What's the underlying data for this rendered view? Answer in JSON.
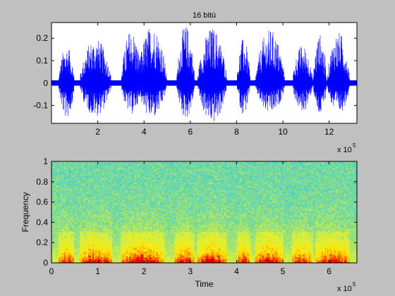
{
  "figure": {
    "background": "#c0c0c0",
    "axes_background": "#ffffff",
    "axis_color": "#000000"
  },
  "chart_data": [
    {
      "type": "line",
      "title": "16 bitù",
      "xlabel": "",
      "ylabel": "",
      "x_exponent_label": "x 10",
      "x_exponent": "5",
      "xlim": [
        0,
        132000
      ],
      "ylim": [
        -0.18,
        0.27
      ],
      "xticks": [
        2,
        4,
        6,
        8,
        10,
        12
      ],
      "yticks": [
        -0.1,
        0,
        0.1,
        0.2
      ],
      "ytick_labels": [
        "-0.1",
        "0",
        "0.1",
        "0.2"
      ],
      "line_color": "#0000ff",
      "series_description": "speech waveform with 13 bursts",
      "bursts": [
        {
          "start": 0.3,
          "end": 1.0,
          "peak": 0.17,
          "min": -0.16
        },
        {
          "start": 1.2,
          "end": 2.6,
          "peak": 0.2,
          "min": -0.15
        },
        {
          "start": 3.0,
          "end": 3.9,
          "peak": 0.24,
          "min": -0.14
        },
        {
          "start": 3.7,
          "end": 5.0,
          "peak": 0.26,
          "min": -0.16
        },
        {
          "start": 5.4,
          "end": 6.2,
          "peak": 0.26,
          "min": -0.16
        },
        {
          "start": 6.3,
          "end": 7.6,
          "peak": 0.25,
          "min": -0.18
        },
        {
          "start": 8.0,
          "end": 8.6,
          "peak": 0.2,
          "min": -0.14
        },
        {
          "start": 8.8,
          "end": 10.1,
          "peak": 0.24,
          "min": -0.14
        },
        {
          "start": 10.4,
          "end": 11.3,
          "peak": 0.17,
          "min": -0.13
        },
        {
          "start": 11.3,
          "end": 11.9,
          "peak": 0.22,
          "min": -0.15
        },
        {
          "start": 11.9,
          "end": 12.9,
          "peak": 0.23,
          "min": -0.14
        }
      ],
      "noise_floor": 0.012
    },
    {
      "type": "heatmap",
      "title": "",
      "xlabel": "Time",
      "ylabel": "Frequency",
      "x_exponent_label": "x 10",
      "x_exponent": "5",
      "xlim": [
        0,
        6.6
      ],
      "ylim": [
        0,
        1
      ],
      "xticks": [
        0,
        1,
        2,
        3,
        4,
        5,
        6
      ],
      "yticks": [
        0,
        0.2,
        0.4,
        0.6,
        0.8,
        1
      ],
      "ytick_labels": [
        "0",
        "0.2",
        "0.4",
        "0.6",
        "0.8",
        "1"
      ],
      "colormap": [
        "#0000ff",
        "#00ffff",
        "#80ff80",
        "#ffff00",
        "#ff8000",
        "#ff0000"
      ],
      "background_color": "#6fd7a8",
      "energy_low": [
        0.3,
        0.45,
        0.95,
        1.5,
        1.9,
        2.6,
        3.2,
        3.9,
        4.4,
        5.0,
        5.6,
        6.2
      ],
      "energy_high_bursts": [
        {
          "start": 0.15,
          "end": 0.5,
          "level": 0.8
        },
        {
          "start": 0.6,
          "end": 1.3,
          "level": 0.9
        },
        {
          "start": 1.5,
          "end": 2.45,
          "level": 0.95
        },
        {
          "start": 2.65,
          "end": 3.1,
          "level": 0.9
        },
        {
          "start": 3.15,
          "end": 3.8,
          "level": 0.95
        },
        {
          "start": 4.0,
          "end": 4.3,
          "level": 0.8
        },
        {
          "start": 4.4,
          "end": 5.0,
          "level": 0.9
        },
        {
          "start": 5.2,
          "end": 5.65,
          "level": 0.8
        },
        {
          "start": 5.7,
          "end": 6.45,
          "level": 0.9
        }
      ]
    }
  ]
}
